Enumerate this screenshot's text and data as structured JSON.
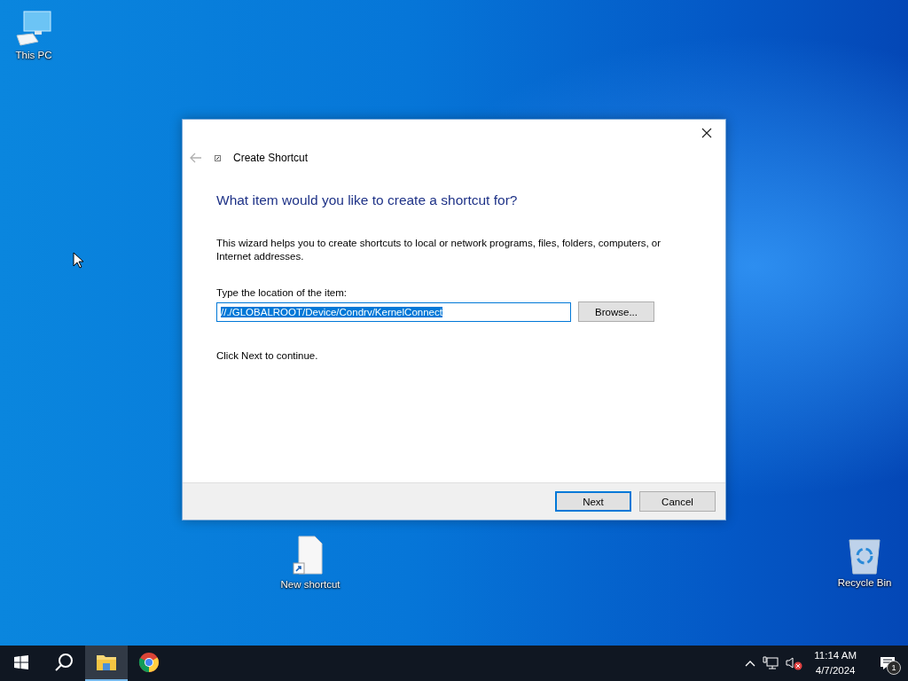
{
  "desktop_icons": [
    {
      "label": "This PC",
      "kind": "computer"
    },
    {
      "label": "New shortcut",
      "kind": "file"
    },
    {
      "label": "Recycle Bin",
      "kind": "recycle"
    }
  ],
  "dialog": {
    "title": "Create Shortcut",
    "back_disabled": true,
    "heading": "What item would you like to create a shortcut for?",
    "description": "This wizard helps you to create shortcuts to local or network programs, files, folders, computers, or Internet addresses.",
    "field_label": "Type the location of the item:",
    "location": "//./GLOBALROOT/Device/Condrv/KernelConnect",
    "location_selected": true,
    "browse_button": "Browse...",
    "hint": "Click Next to continue.",
    "buttons": [
      {
        "label": "Next",
        "default": true
      },
      {
        "label": "Cancel",
        "default": false
      }
    ]
  },
  "taskbar": {
    "apps": [
      {
        "kind": "explorer",
        "selected": true
      },
      {
        "kind": "chrome",
        "selected": false
      }
    ],
    "time": "11:14 AM",
    "date": "4/7/2024",
    "notification_count": "1"
  }
}
